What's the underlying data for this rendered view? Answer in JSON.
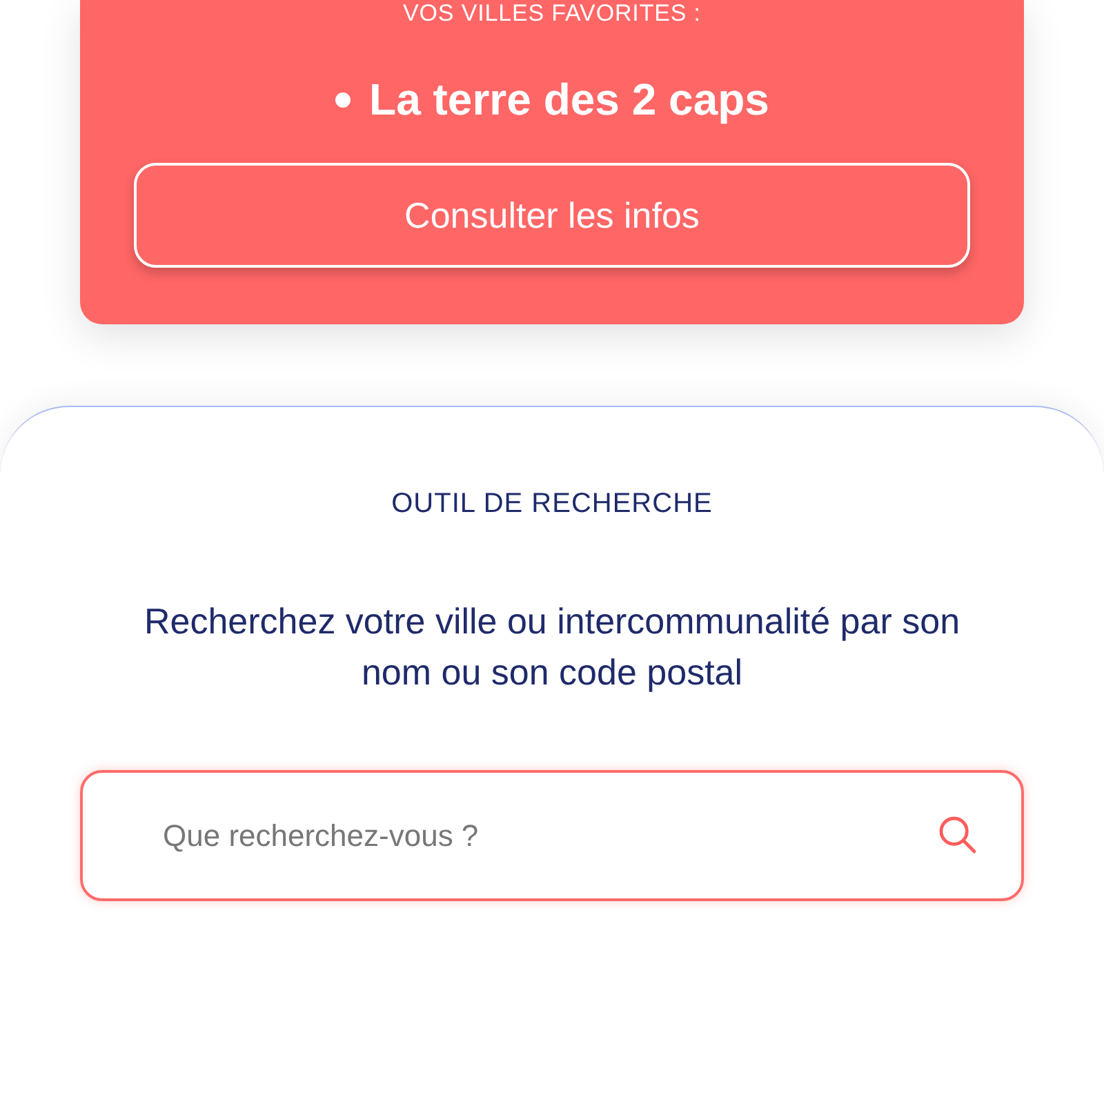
{
  "favorites_card": {
    "label": "VOS VILLES FAVORITES :",
    "items": [
      {
        "name": "La terre des 2 caps"
      }
    ],
    "button": "Consulter les infos"
  },
  "search_tool": {
    "heading": "OUTIL DE RECHERCHE",
    "description": "Recherchez votre ville ou intercommunalité par son nom ou son code postal",
    "search": {
      "placeholder": "Que recherchez-vous ?"
    }
  }
}
